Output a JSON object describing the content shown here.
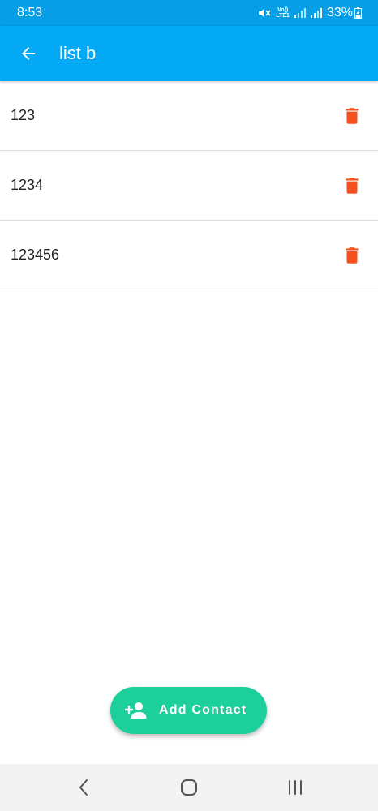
{
  "status_bar": {
    "time": "8:53",
    "volte_top": "Vo))",
    "volte_bottom": "LTE1",
    "battery": "33%"
  },
  "app_bar": {
    "title": "list b",
    "background": "#03a9f4"
  },
  "contacts": [
    {
      "label": "123"
    },
    {
      "label": "1234"
    },
    {
      "label": "123456"
    }
  ],
  "fab": {
    "label": "Add Contact",
    "color": "#1ccf9b"
  },
  "colors": {
    "delete_icon": "#f4511e",
    "status_bar": "#069ee6"
  },
  "icons": {
    "back": "arrow-left-icon",
    "delete": "trash-icon",
    "add_contact": "person-add-icon",
    "nav_back": "chevron-left-icon",
    "nav_home": "home-square-icon",
    "nav_recents": "recents-icon"
  }
}
